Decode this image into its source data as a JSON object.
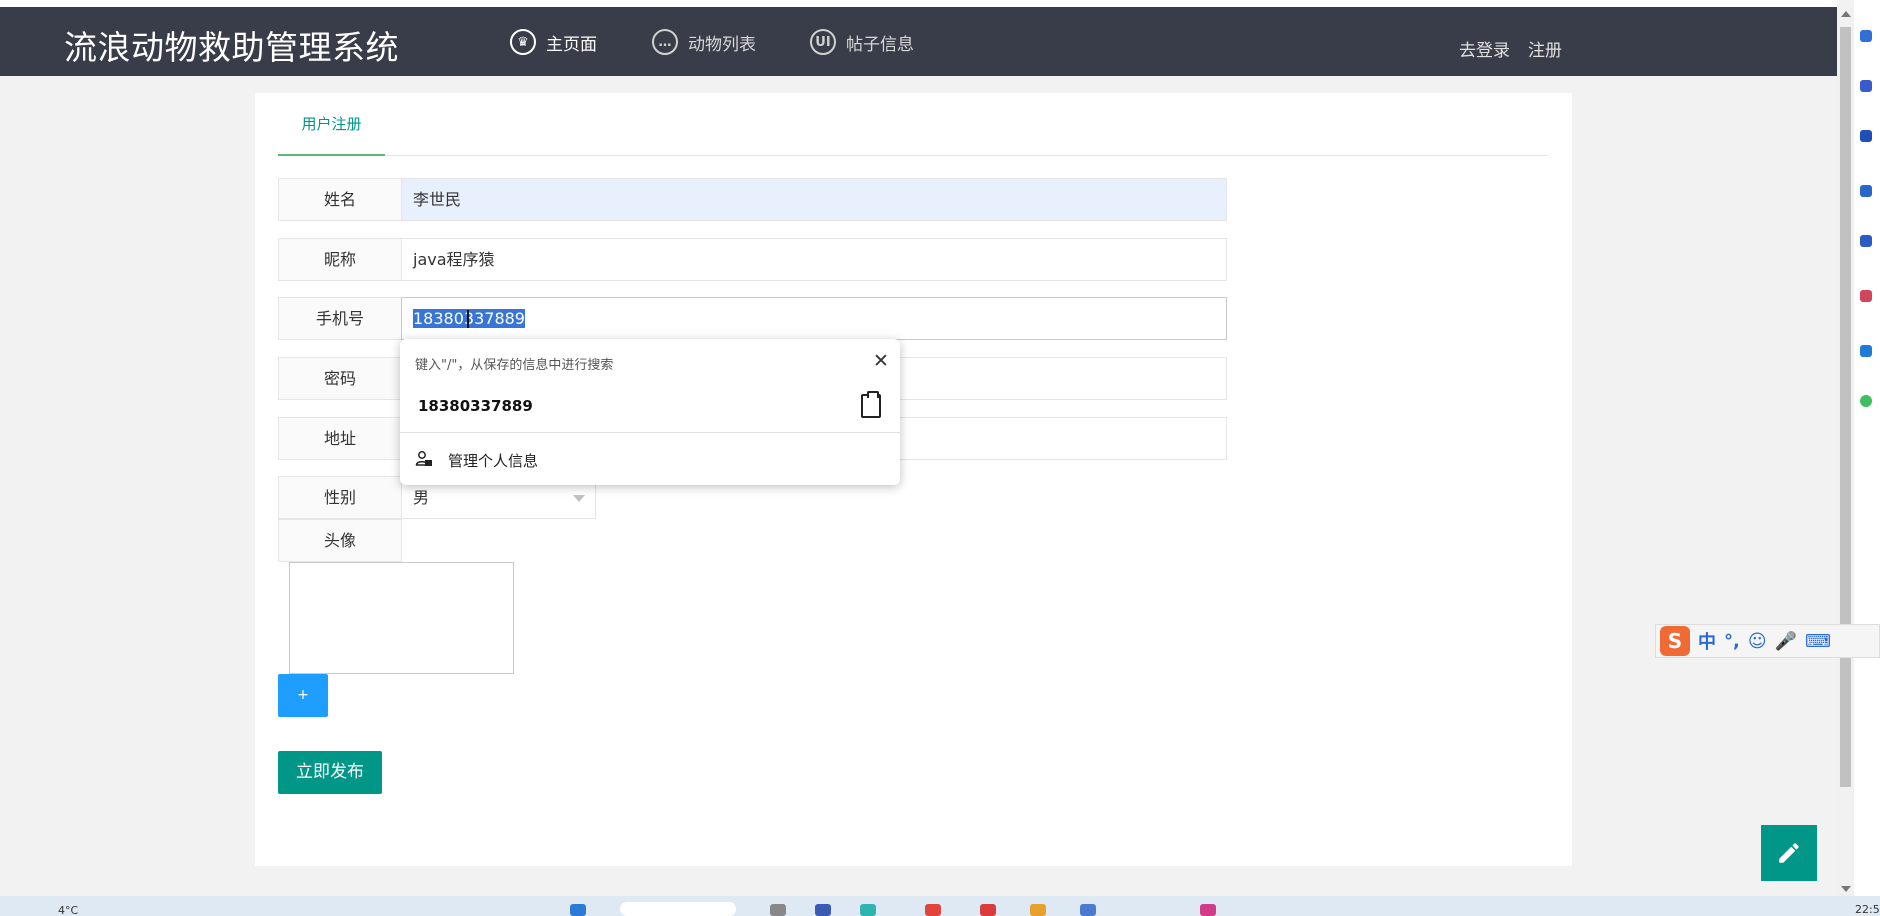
{
  "app": {
    "title": "流浪动物救助管理系统"
  },
  "nav": {
    "items": [
      {
        "label": "主页面",
        "icon": "crown-icon"
      },
      {
        "label": "动物列表",
        "icon": "chat-bubble-icon"
      },
      {
        "label": "帖子信息",
        "icon": "ui-badge-icon"
      }
    ],
    "login": "去登录",
    "register": "注册"
  },
  "form": {
    "tab_label": "用户注册",
    "fields": [
      {
        "label": "姓名",
        "value": "李世民"
      },
      {
        "label": "昵称",
        "value": "java程序猿"
      },
      {
        "label": "手机号",
        "value": "18380337889"
      },
      {
        "label": "密码",
        "value": ""
      },
      {
        "label": "地址",
        "value": ""
      }
    ],
    "gender": {
      "label": "性别",
      "value": "男"
    },
    "avatar": {
      "label": "头像"
    },
    "upload_label": "+",
    "submit_label": "立即发布"
  },
  "autofill": {
    "hint": "键入\"/\"，从保存的信息中进行搜索",
    "suggestion": "18380337889",
    "manage_label": "管理个人信息"
  },
  "ime": {
    "items": [
      "中",
      "°,",
      "☺",
      "🎤",
      "⌨"
    ]
  },
  "taskbar": {
    "temp": "4°C",
    "time": "22:5"
  },
  "colors": {
    "header_bg": "#393d49",
    "accent": "#009688",
    "upload_btn": "#1e9fff",
    "autofill_bg": "#e8f0fe"
  }
}
